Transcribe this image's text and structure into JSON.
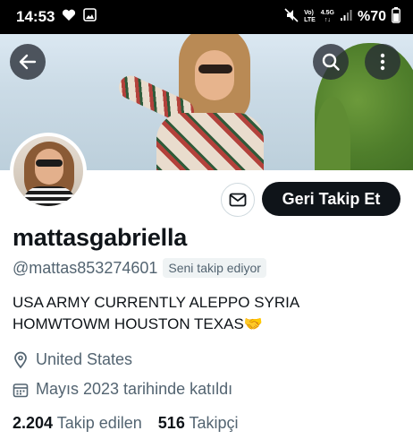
{
  "status_bar": {
    "time": "14:53",
    "lte_top": "Vo)",
    "lte_bottom": "LTE",
    "net_top": "4.5G",
    "net_bottom": "↑↓",
    "battery": "%70"
  },
  "header": {
    "back_icon": "arrow-left-icon",
    "search_icon": "search-icon",
    "more_icon": "more-vertical-icon"
  },
  "profile": {
    "name": "mattasgabriella",
    "handle": "@mattas853274601",
    "follows_you": "Seni takip ediyor",
    "bio": "USA ARMY  CURRENTLY ALEPPO SYRIA\nHOMWTOWM HOUSTON TEXAS🤝",
    "location": "United States",
    "joined": "Mayıs 2023 tarihinde katıldı",
    "following_count": "2.204",
    "following_label": "Takip edilen",
    "followers_count": "516",
    "followers_label": "Takipçi"
  },
  "actions": {
    "follow_back": "Geri Takip Et",
    "message_icon": "mail-icon"
  },
  "colors": {
    "primary_text": "#0f1419",
    "secondary_text": "#536471",
    "button_dark": "#0f1419"
  }
}
